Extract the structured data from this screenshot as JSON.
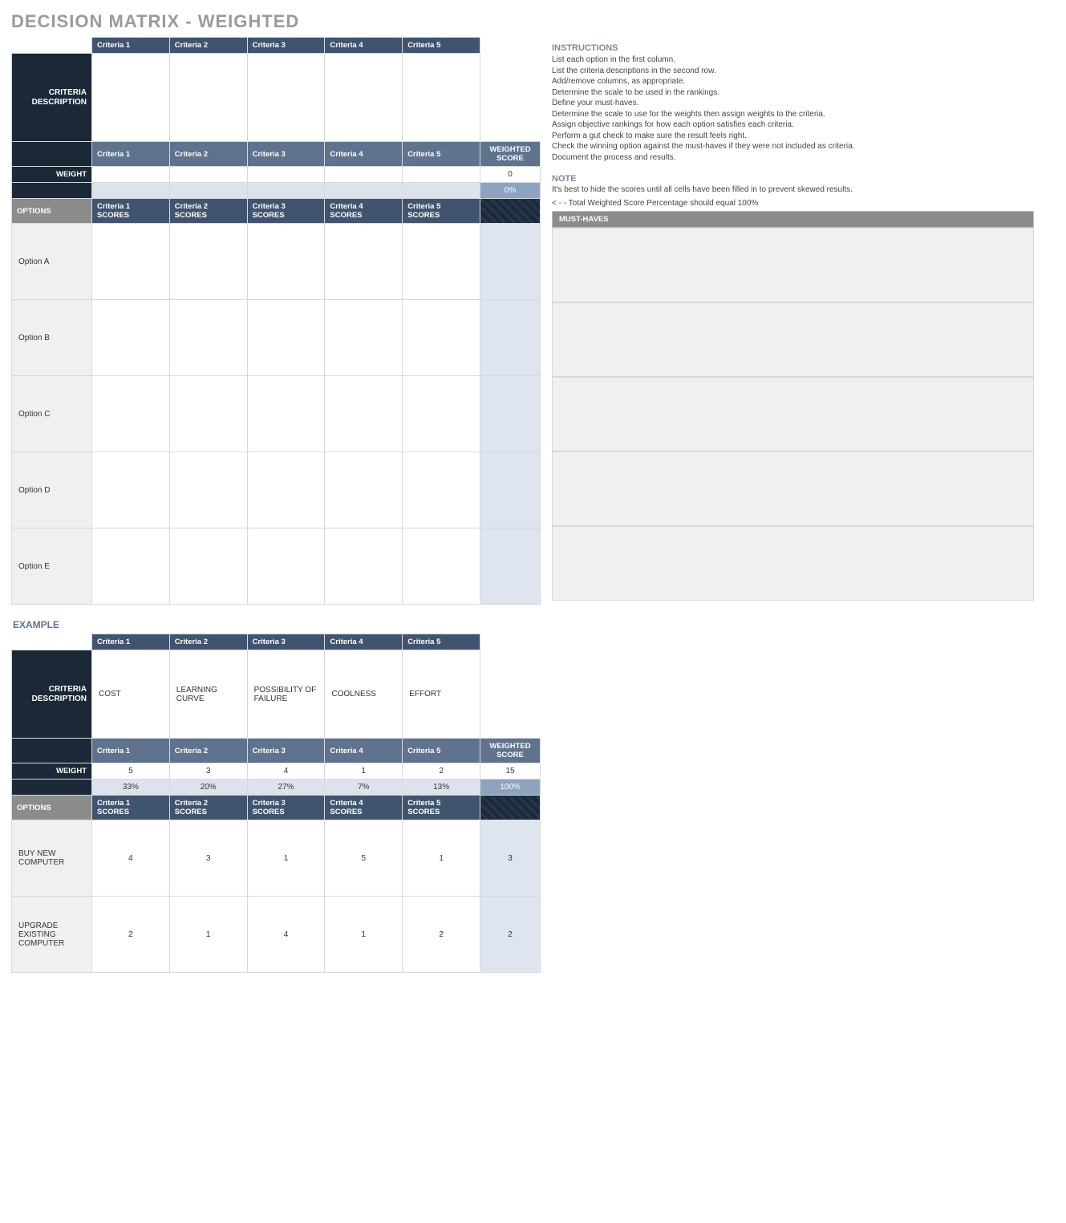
{
  "title": "DECISION MATRIX - WEIGHTED",
  "main": {
    "criteria_header": [
      "Criteria 1",
      "Criteria 2",
      "Criteria 3",
      "Criteria 4",
      "Criteria 5"
    ],
    "criteria_desc_label": "CRITERIA DESCRIPTION",
    "criteria_desc": [
      "",
      "",
      "",
      "",
      ""
    ],
    "criteria_repeat": [
      "Criteria 1",
      "Criteria 2",
      "Criteria 3",
      "Criteria 4",
      "Criteria 5"
    ],
    "weighted_score_label": "WEIGHTED SCORE",
    "weight_label": "WEIGHT",
    "weights": [
      "",
      "",
      "",
      "",
      ""
    ],
    "weight_total": "0",
    "weight_pct": [
      "",
      "",
      "",
      "",
      ""
    ],
    "weight_pct_total": "0%",
    "options_label": "OPTIONS",
    "scores_header": [
      "Criteria 1 SCORES",
      "Criteria 2 SCORES",
      "Criteria 3 SCORES",
      "Criteria 4 SCORES",
      "Criteria 5 SCORES"
    ],
    "options": [
      {
        "name": "Option A",
        "scores": [
          "",
          "",
          "",
          "",
          ""
        ],
        "ws": ""
      },
      {
        "name": "Option B",
        "scores": [
          "",
          "",
          "",
          "",
          ""
        ],
        "ws": ""
      },
      {
        "name": "Option C",
        "scores": [
          "",
          "",
          "",
          "",
          ""
        ],
        "ws": ""
      },
      {
        "name": "Option D",
        "scores": [
          "",
          "",
          "",
          "",
          ""
        ],
        "ws": ""
      },
      {
        "name": "Option E",
        "scores": [
          "",
          "",
          "",
          "",
          ""
        ],
        "ws": ""
      }
    ]
  },
  "example_label": "EXAMPLE",
  "example": {
    "criteria_header": [
      "Criteria 1",
      "Criteria 2",
      "Criteria 3",
      "Criteria 4",
      "Criteria 5"
    ],
    "criteria_desc_label": "CRITERIA DESCRIPTION",
    "criteria_desc": [
      "COST",
      "LEARNING CURVE",
      "POSSIBILITY OF FAILURE",
      "COOLNESS",
      "EFFORT"
    ],
    "criteria_repeat": [
      "Criteria 1",
      "Criteria 2",
      "Criteria 3",
      "Criteria 4",
      "Criteria 5"
    ],
    "weighted_score_label": "WEIGHTED SCORE",
    "weight_label": "WEIGHT",
    "weights": [
      "5",
      "3",
      "4",
      "1",
      "2"
    ],
    "weight_total": "15",
    "weight_pct": [
      "33%",
      "20%",
      "27%",
      "7%",
      "13%"
    ],
    "weight_pct_total": "100%",
    "options_label": "OPTIONS",
    "scores_header": [
      "Criteria 1 SCORES",
      "Criteria 2 SCORES",
      "Criteria 3 SCORES",
      "Criteria 4 SCORES",
      "Criteria 5 SCORES"
    ],
    "options": [
      {
        "name": "BUY NEW COMPUTER",
        "scores": [
          "4",
          "3",
          "1",
          "5",
          "1"
        ],
        "ws": "3"
      },
      {
        "name": "UPGRADE EXISTING COMPUTER",
        "scores": [
          "2",
          "1",
          "4",
          "1",
          "2"
        ],
        "ws": "2"
      }
    ]
  },
  "side": {
    "instructions_label": "INSTRUCTIONS",
    "instructions": [
      "List each option in the first column.",
      "List the criteria descriptions in the second row.",
      "Add/remove columns, as appropriate.",
      "Determine the scale to be used in the rankings.",
      "Define your must-haves.",
      "Determine the scale to use for the weights then assign weights to the criteria.",
      "Assign objective rankings for how each option satisfies each criteria.",
      "Perform a gut check to make sure the result feels right.",
      "Check the winning option against the must-haves if they were not included as criteria.",
      "Document the process and results."
    ],
    "note_label": "NOTE",
    "note_text": "It's best to hide the scores until all cells have been filled in to prevent skewed results.",
    "arrow_text": "< - - Total Weighted Score Percentage should equal 100%",
    "musthaves_label": "MUST-HAVES",
    "musthave_slots": 5
  }
}
